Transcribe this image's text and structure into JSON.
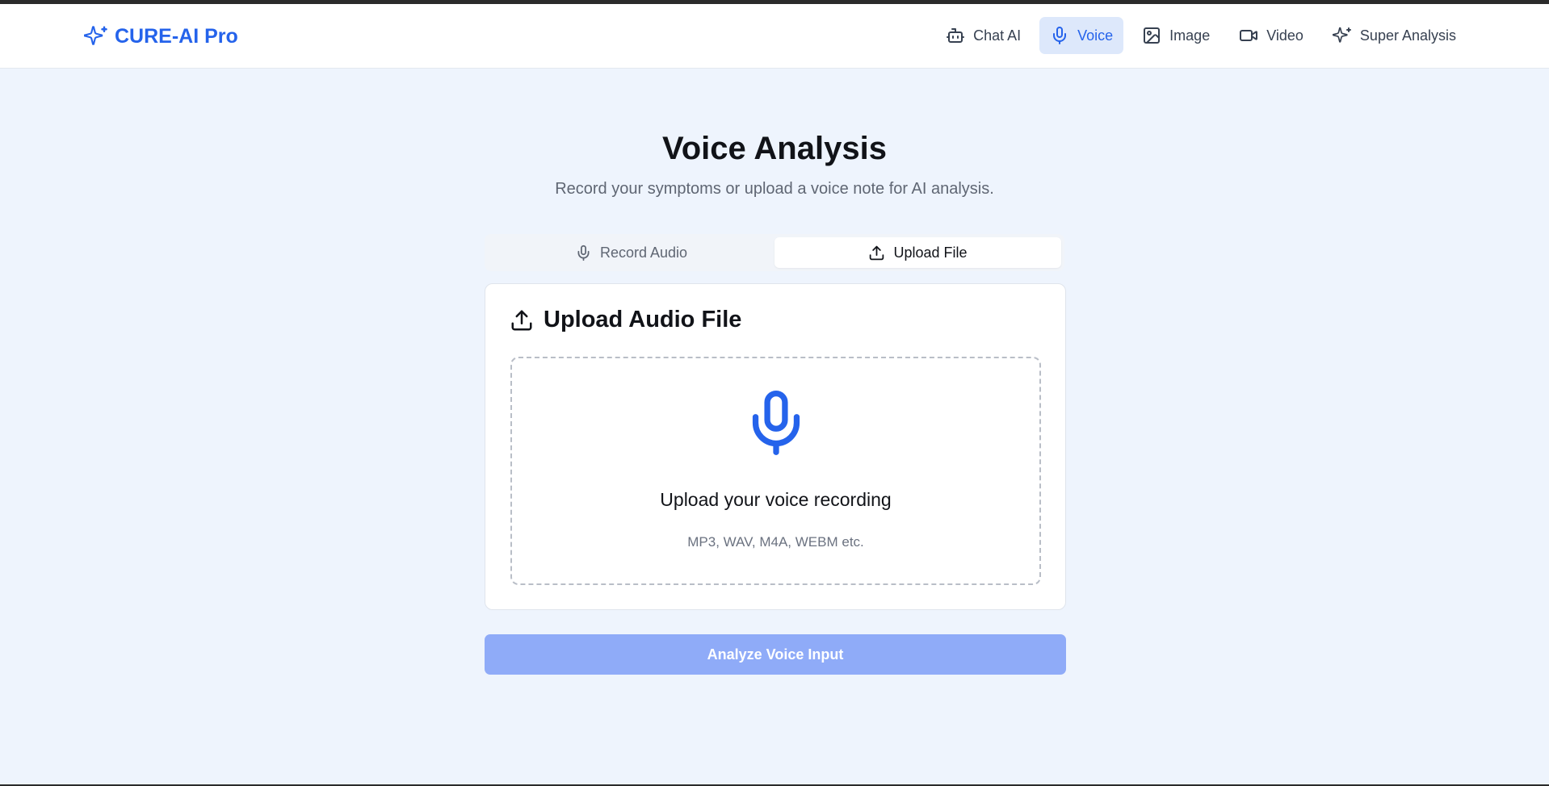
{
  "brand": {
    "name": "CURE-AI Pro",
    "icon": "sparkles-icon",
    "color": "#2563eb"
  },
  "nav": {
    "items": [
      {
        "label": "Chat AI",
        "icon": "bot-icon",
        "active": false
      },
      {
        "label": "Voice",
        "icon": "mic-icon",
        "active": true
      },
      {
        "label": "Image",
        "icon": "image-icon",
        "active": false
      },
      {
        "label": "Video",
        "icon": "video-icon",
        "active": false
      },
      {
        "label": "Super Analysis",
        "icon": "sparkles-icon",
        "active": false
      }
    ]
  },
  "page": {
    "title": "Voice Analysis",
    "subtitle": "Record your symptoms or upload a voice note for AI analysis."
  },
  "tabs": [
    {
      "label": "Record Audio",
      "icon": "mic-icon",
      "active": false
    },
    {
      "label": "Upload File",
      "icon": "upload-icon",
      "active": true
    }
  ],
  "upload_card": {
    "title": "Upload Audio File",
    "title_icon": "upload-icon",
    "dropzone_icon": "mic-icon",
    "dropzone_text": "Upload your voice recording",
    "dropzone_formats": "MP3, WAV, M4A, WEBM etc."
  },
  "analyze_button": {
    "label": "Analyze Voice Input",
    "enabled": false
  },
  "colors": {
    "accent": "#2563eb",
    "background": "#eef4fd",
    "button_disabled": "#8fabf8"
  }
}
